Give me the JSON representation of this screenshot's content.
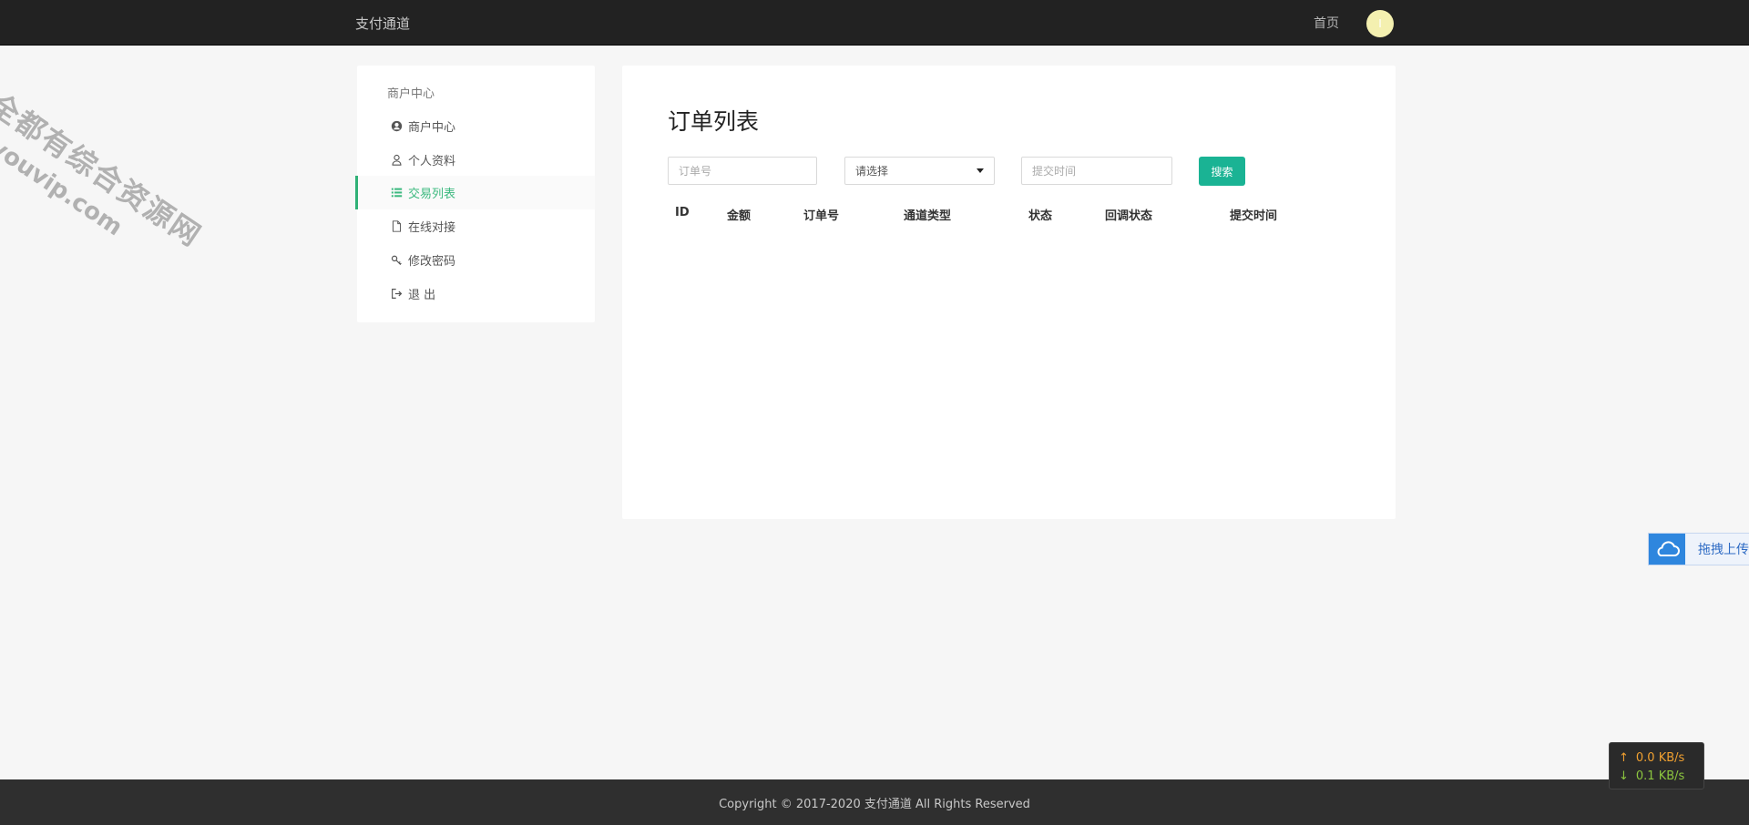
{
  "header": {
    "brand": "支付通道",
    "nav_home": "首页",
    "avatar_initial": "I"
  },
  "sidebar": {
    "title": "商户中心",
    "items": [
      {
        "label": "商户中心",
        "icon": "user-circle-icon"
      },
      {
        "label": "个人资料",
        "icon": "user-icon"
      },
      {
        "label": "交易列表",
        "icon": "list-icon",
        "active": true
      },
      {
        "label": "在线对接",
        "icon": "document-icon"
      },
      {
        "label": "修改密码",
        "icon": "key-icon"
      },
      {
        "label": "退 出",
        "icon": "sign-out-icon"
      }
    ],
    "active_color": "#3cb97f"
  },
  "main": {
    "title": "订单列表",
    "filters": {
      "order_placeholder": "订单号",
      "select_value": "请选择",
      "time_placeholder": "提交时间",
      "search_label": "搜索"
    },
    "table": {
      "columns": [
        "ID",
        "金额",
        "订单号",
        "通道类型",
        "状态",
        "回调状态",
        "提交时间"
      ],
      "rows": []
    },
    "accent_color": "#1ab394"
  },
  "footer": {
    "text": "Copyright © 2017-2020 支付通道 All Rights Reserved"
  },
  "widgets": {
    "upload_label": "拖拽上传",
    "upload_icon": "cloud-upload-icon",
    "upload_speed": "0.0 KB/s",
    "download_speed": "0.1 KB/s"
  },
  "watermark": {
    "cn": "全都有综合资源网",
    "en": "douyouvip.com"
  }
}
